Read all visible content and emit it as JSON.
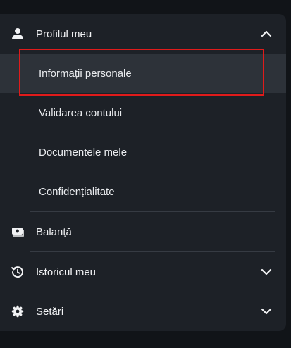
{
  "menu": {
    "profile": {
      "icon": "user-icon",
      "label": "Profilul meu",
      "chevron": "chevron-up-icon",
      "items": [
        {
          "label": "Informații personale",
          "active": true
        },
        {
          "label": "Validarea contului",
          "active": false
        },
        {
          "label": "Documentele mele",
          "active": false
        },
        {
          "label": "Confidențialitate",
          "active": false
        }
      ]
    },
    "balance": {
      "icon": "wallet-icon",
      "label": "Balanță"
    },
    "history": {
      "icon": "history-icon",
      "label": "Istoricul meu",
      "chevron": "chevron-down-icon"
    },
    "settings": {
      "icon": "gear-icon",
      "label": "Setări",
      "chevron": "chevron-down-icon"
    }
  },
  "colors": {
    "background": "#111418",
    "panel": "#1d2127",
    "active_item": "#2d3239",
    "divider": "#363b43",
    "text": "#f1f2f4",
    "highlight_border": "#e01b1b"
  }
}
